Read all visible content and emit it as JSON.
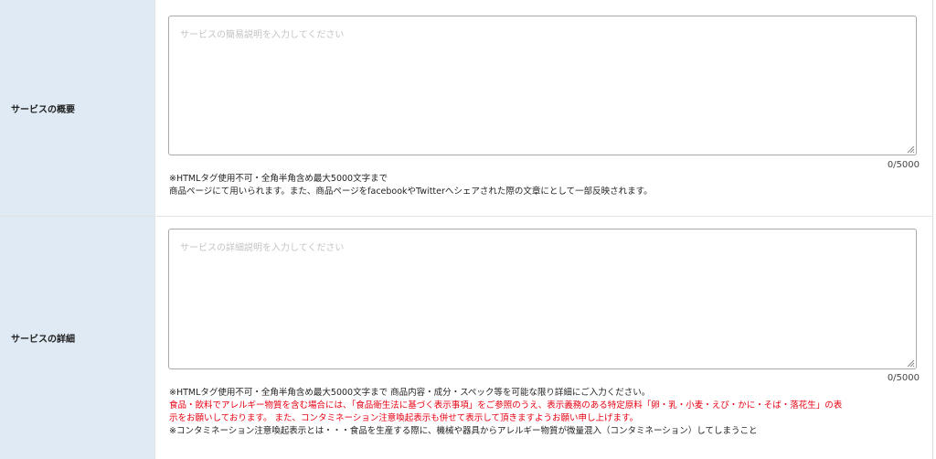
{
  "overview": {
    "label": "サービスの概要",
    "placeholder": "サービスの簡易説明を入力してください",
    "counter": "0/5000",
    "note_line1": "※HTMLタグ使用不可・全角半角含め最大5000文字まで",
    "note_line2": "商品ページにて用いられます。また、商品ページをfacebookやTwitterへシェアされた際の文章にとして一部反映されます。"
  },
  "detail": {
    "label": "サービスの詳細",
    "placeholder": "サービスの詳細説明を入力してください",
    "counter": "0/5000",
    "note_line1": "※HTMLタグ使用不可・全角半角含め最大5000文字まで 商品内容・成分・スペック等を可能な限り詳細にご入力ください。",
    "warning_line1": "食品・飲料でアレルギー物質を含む場合には、「食品衛生法に基づく表示事項」をご参照のうえ、表示義務のある特定原料「卵・乳・小麦・えび・かに・そば・落花生」の表",
    "warning_line2": "示をお願いしております。 また、コンタミネーション注意喚起表示も併せて表示して頂きますようお願い申し上げます。",
    "note_line4": "※コンタミネーション注意喚起表示とは・・・食品を生産する際に、機械や器具からアレルギー物質が微量混入（コンタミネーション）してしまうこと"
  },
  "colors": {
    "label_bg": "#dfeaf4",
    "warning": "#e60012",
    "placeholder": "#c4c4c4"
  }
}
